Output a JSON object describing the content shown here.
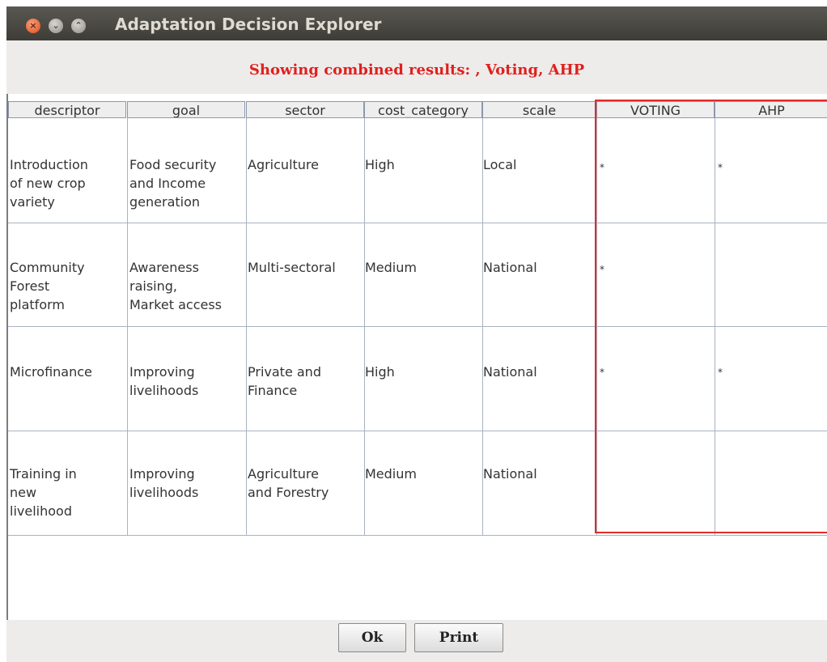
{
  "window": {
    "title": "Adaptation Decision Explorer",
    "buttons": {
      "close": "×",
      "minimize": "⌄",
      "maximize": "⌃"
    }
  },
  "heading": "Showing combined results: , Voting, AHP",
  "table": {
    "columns": [
      "descriptor",
      "goal",
      "sector",
      "cost_category",
      "scale",
      "VOTING",
      "AHP"
    ],
    "rows": [
      {
        "descriptor": [
          "Introduction",
          "of new crop",
          "variety"
        ],
        "goal": [
          "Food security",
          "and Income",
          "generation"
        ],
        "sector": [
          "Agriculture"
        ],
        "cost": [
          "High"
        ],
        "scale": [
          "Local"
        ],
        "voting": "*",
        "ahp": "*"
      },
      {
        "descriptor": [
          "Community",
          "Forest",
          "platform"
        ],
        "goal": [
          "Awareness",
          "raising,",
          "Market access"
        ],
        "sector": [
          "Multi-sectoral"
        ],
        "cost": [
          "Medium"
        ],
        "scale": [
          "National"
        ],
        "voting": "*",
        "ahp": ""
      },
      {
        "descriptor": [
          "Microfinance"
        ],
        "goal": [
          "Improving",
          "livelihoods"
        ],
        "sector": [
          "Private and",
          "Finance"
        ],
        "cost": [
          "High"
        ],
        "scale": [
          "National"
        ],
        "voting": "*",
        "ahp": "*"
      },
      {
        "descriptor": [
          "Training in",
          "new",
          "livelihood"
        ],
        "goal": [
          "Improving",
          "livelihoods"
        ],
        "sector": [
          "Agriculture",
          "and Forestry"
        ],
        "cost": [
          "Medium"
        ],
        "scale": [
          "National"
        ],
        "voting": "",
        "ahp": ""
      }
    ]
  },
  "footer": {
    "ok_label": "Ok",
    "print_label": "Print"
  },
  "colors": {
    "highlight": "#e0201d",
    "titlebar": "#3e3c37",
    "grid": "#a9b2c1"
  }
}
